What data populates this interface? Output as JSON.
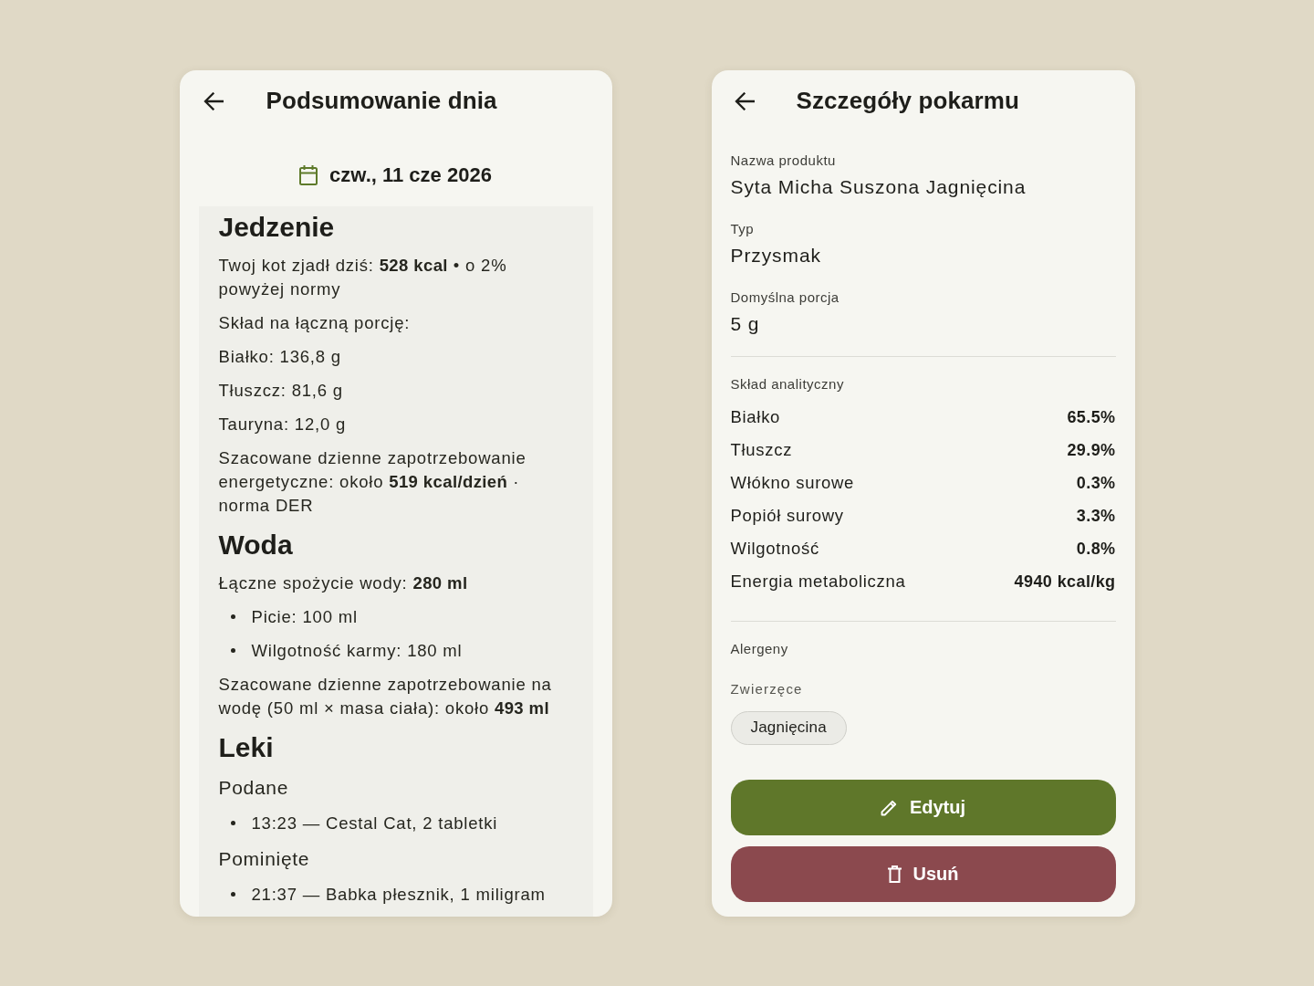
{
  "summary_screen": {
    "title": "Podsumowanie dnia",
    "date": "czw., 11 cze 2026",
    "sections": [
      {
        "heading": "Jedzenie",
        "blocks": [
          {
            "kind": "paragraph",
            "text": "Twoj kot zjadł dziś: **528 kcal** • o 2% powyżej normy"
          },
          {
            "kind": "paragraph",
            "text": "Skład na łączną porcję:"
          },
          {
            "kind": "paragraph",
            "text": "Białko: 136,8 g"
          },
          {
            "kind": "paragraph",
            "text": "Tłuszcz: 81,6 g"
          },
          {
            "kind": "paragraph",
            "text": "Tauryna: 12,0 g"
          },
          {
            "kind": "paragraph",
            "text": "Szacowane dzienne zapotrzebowanie energetyczne: około **519 kcal/dzień** · norma DER"
          }
        ]
      },
      {
        "heading": "Woda",
        "blocks": [
          {
            "kind": "paragraph",
            "text": "Łączne spożycie wody: **280 ml**"
          },
          {
            "kind": "bullets",
            "items": [
              "Picie: 100 ml",
              "Wilgotność karmy: 180 ml"
            ]
          },
          {
            "kind": "paragraph",
            "text": "Szacowane dzienne zapotrzebowanie na wodę (50 ml × masa ciała): około **493 ml**"
          }
        ]
      },
      {
        "heading": "Leki",
        "blocks": [
          {
            "kind": "subheading",
            "text": "Podane"
          },
          {
            "kind": "bullets",
            "items": [
              "13:23 — Cestal Cat, 2 tabletki"
            ]
          },
          {
            "kind": "subheading",
            "text": "Pominięte"
          },
          {
            "kind": "bullets",
            "items": [
              "21:37 — Babka płesznik, 1 miligram"
            ]
          }
        ]
      }
    ]
  },
  "food_details_screen": {
    "title": "Szczegóły pokarmu",
    "fields": [
      {
        "label": "Nazwa produktu",
        "value": "Syta Micha Suszona Jagnięcina"
      },
      {
        "label": "Typ",
        "value": "Przysmak"
      },
      {
        "label": "Domyślna porcja",
        "value": "5 g"
      }
    ],
    "composition": {
      "label": "Skład analityczny",
      "rows": [
        {
          "name": "Białko",
          "value": "65.5%"
        },
        {
          "name": "Tłuszcz",
          "value": "29.9%"
        },
        {
          "name": "Włókno surowe",
          "value": "0.3%"
        },
        {
          "name": "Popiół surowy",
          "value": "3.3%"
        },
        {
          "name": "Wilgotność",
          "value": "0.8%"
        },
        {
          "name": "Energia metaboliczna",
          "value": "4940 kcal/kg"
        }
      ]
    },
    "allergens": {
      "label": "Alergeny",
      "groups": [
        {
          "label": "Zwierzęce",
          "chips": [
            "Jagnięcina"
          ]
        }
      ]
    },
    "buttons": [
      {
        "kind": "edit",
        "label": "Edytuj"
      },
      {
        "kind": "delete",
        "label": "Usuń"
      }
    ]
  }
}
